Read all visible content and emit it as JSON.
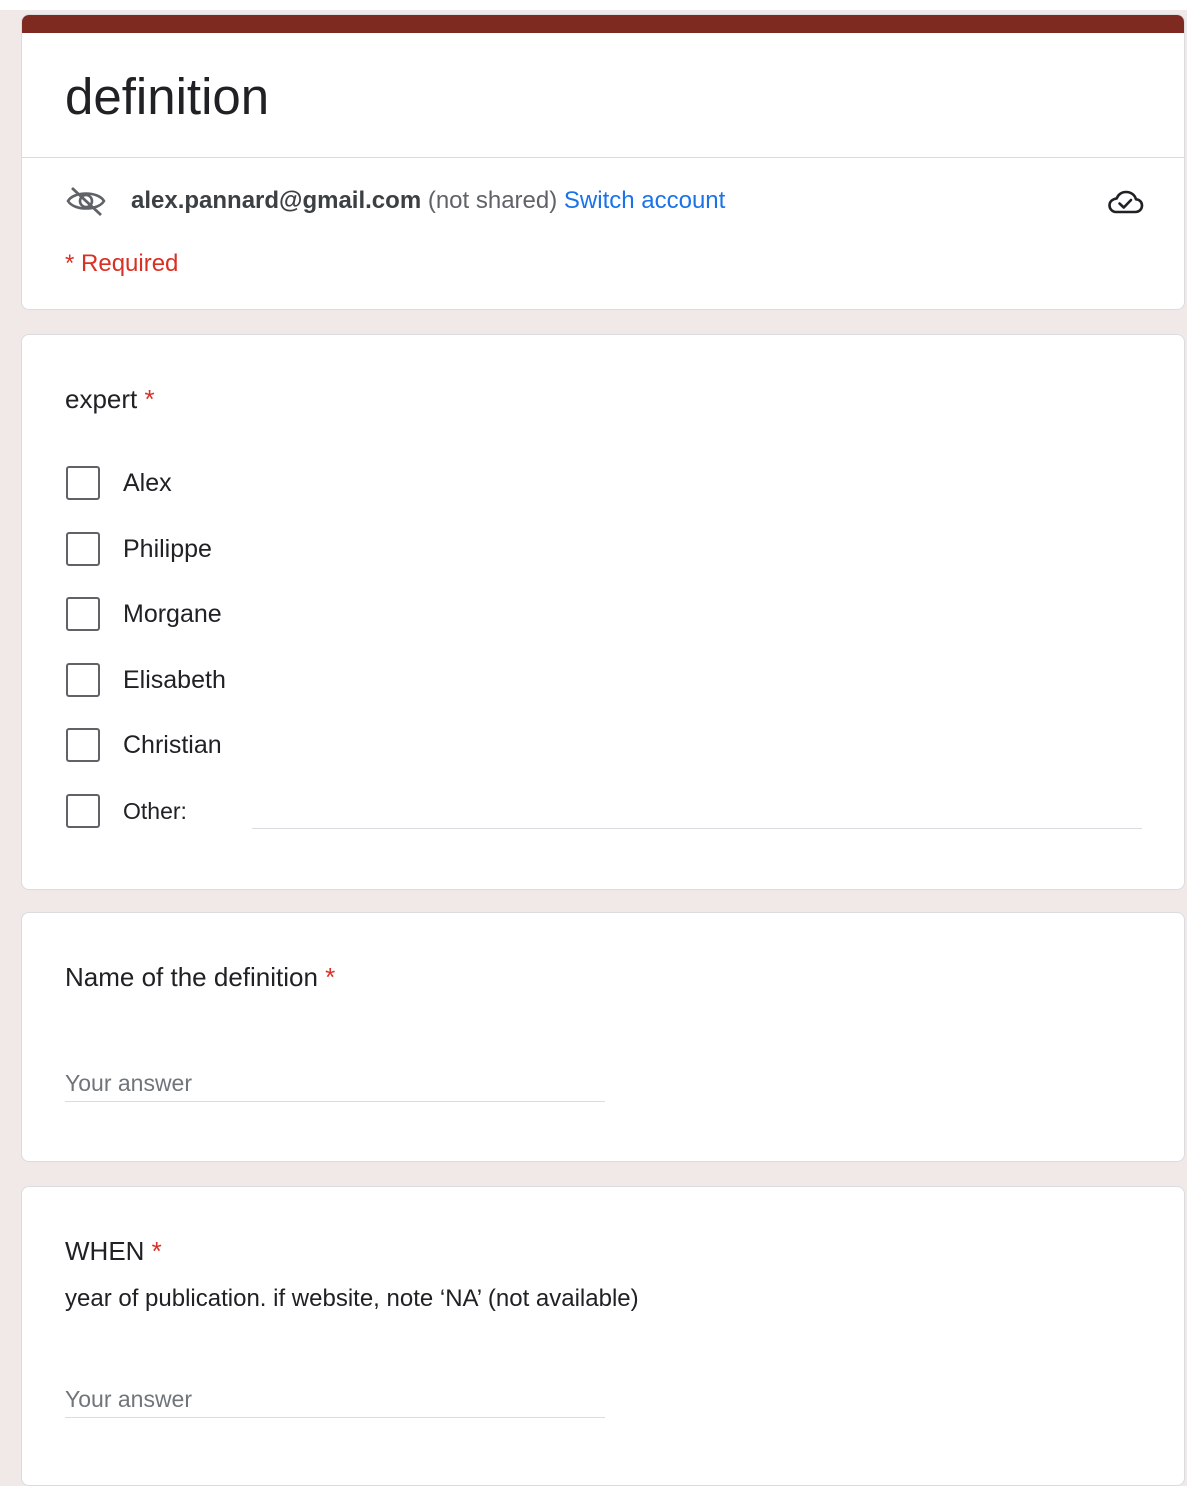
{
  "form": {
    "title": "definition",
    "theme_color": "#7f2a20"
  },
  "account": {
    "email": "alex.pannard@gmail.com",
    "not_shared": "(not shared)",
    "switch_label": "Switch account",
    "hidden_icon": "eye-off-icon",
    "save_icon": "cloud-check-icon"
  },
  "required_note": "* Required",
  "questions": [
    {
      "title": "expert",
      "required_mark": "*",
      "options": [
        "Alex",
        "Philippe",
        "Morgane",
        "Elisabeth",
        "Christian"
      ],
      "other_label": "Other:"
    },
    {
      "title": "Name of the definition",
      "required_mark": "*",
      "placeholder": "Your answer"
    },
    {
      "title": "WHEN",
      "required_mark": "*",
      "description": "year of publication. if website, note ‘NA’ (not available)",
      "placeholder": "Your answer"
    }
  ]
}
